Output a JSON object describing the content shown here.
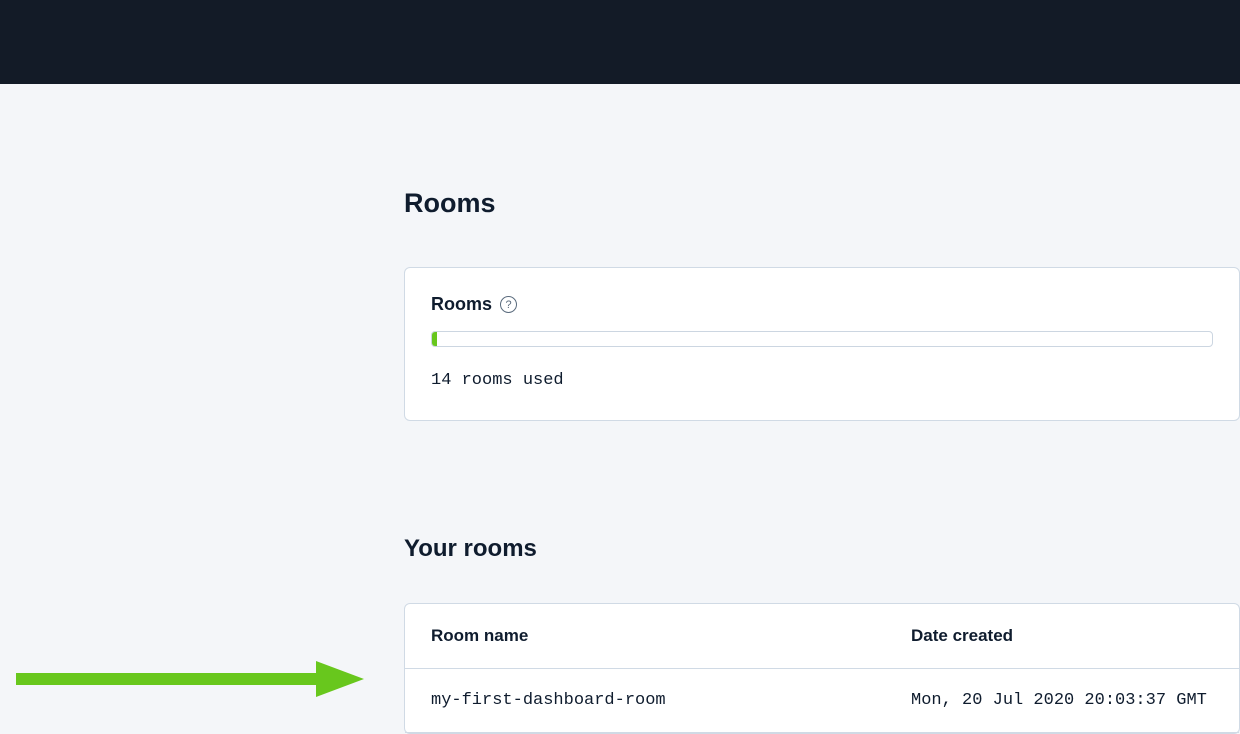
{
  "sections": {
    "rooms": {
      "title": "Rooms",
      "card": {
        "label": "Rooms",
        "status_text": "14 rooms used"
      }
    },
    "your_rooms": {
      "title": "Your rooms",
      "table": {
        "headers": {
          "name": "Room name",
          "date": "Date created"
        },
        "rows": [
          {
            "name": "my-first-dashboard-room",
            "date": "Mon, 20 Jul 2020 20:03:37 GMT"
          }
        ]
      }
    }
  },
  "colors": {
    "accent_green": "#68c71d",
    "top_bar": "#131b27",
    "background": "#f4f6f9",
    "card_border": "#d0dae5",
    "text": "#0f1c2e"
  }
}
